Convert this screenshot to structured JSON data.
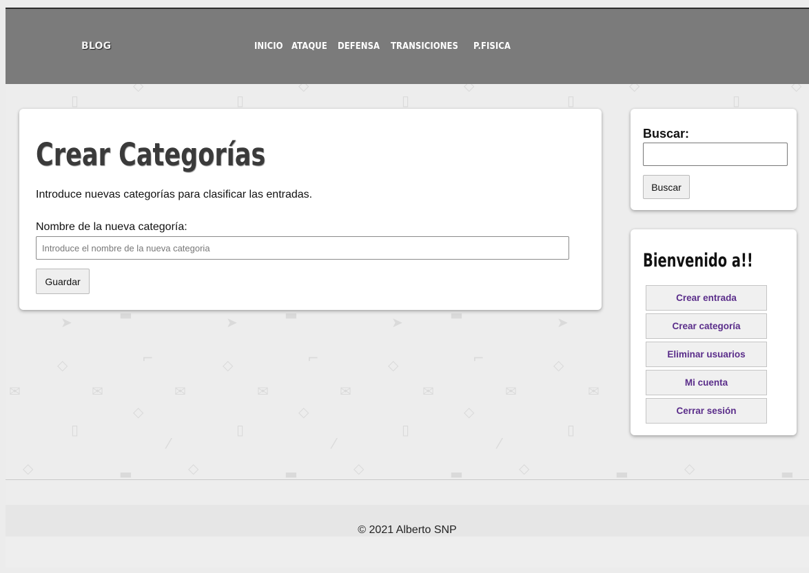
{
  "header": {
    "brand": "BLOG",
    "nav": [
      "INICIO",
      "ATAQUE",
      "DEFENSA",
      "TRANSICIONES",
      "P.FISICA"
    ]
  },
  "main": {
    "title": "Crear Categorías",
    "intro": "Introduce nuevas categorías para clasificar las entradas.",
    "field_label": "Nombre de la nueva categoría:",
    "field_placeholder": "Introduce el nombre de la nueva categoria",
    "field_value": "",
    "save_label": "Guardar"
  },
  "sidebar": {
    "search_title": "Buscar:",
    "search_value": "",
    "search_button": "Buscar",
    "welcome_title": "Bienvenido a!!",
    "menu": [
      "Crear entrada",
      "Crear categoría",
      "Eliminar usuarios",
      "Mi cuenta",
      "Cerrar sesión"
    ]
  },
  "footer": {
    "copyright": "© 2021 Alberto SNP"
  },
  "colors": {
    "header_bg": "#7b7b7b",
    "page_bg": "#ececec",
    "menu_link": "#5a2d8a"
  }
}
